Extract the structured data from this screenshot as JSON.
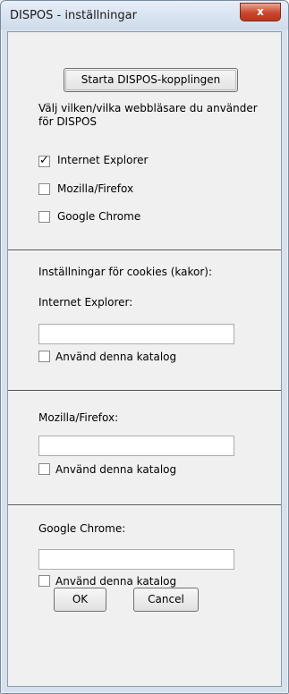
{
  "window": {
    "title": "DISPOS - inställningar",
    "close_icon": "close-icon",
    "close_glyph": "x"
  },
  "main": {
    "start_button": "Starta DISPOS-kopplingen",
    "browser_prompt": "Välj vilken/vilka webbläsare du använder för DISPOS",
    "browsers": [
      {
        "label": "Internet Explorer",
        "checked": true,
        "mark": "✓"
      },
      {
        "label": "Mozilla/Firefox",
        "checked": false,
        "mark": ""
      },
      {
        "label": "Google Chrome",
        "checked": false,
        "mark": ""
      }
    ]
  },
  "cookies": {
    "heading": "Inställningar för cookies (kakor):",
    "sections": [
      {
        "label": "Internet Explorer:",
        "path_value": "",
        "use_dir_label": "Använd denna katalog",
        "use_dir_checked": false
      },
      {
        "label": "Mozilla/Firefox:",
        "path_value": "",
        "use_dir_label": "Använd denna katalog",
        "use_dir_checked": false
      },
      {
        "label": "Google Chrome:",
        "path_value": "",
        "use_dir_label": "Använd denna katalog",
        "use_dir_checked": false
      }
    ]
  },
  "footer": {
    "ok_label": "OK",
    "cancel_label": "Cancel"
  }
}
